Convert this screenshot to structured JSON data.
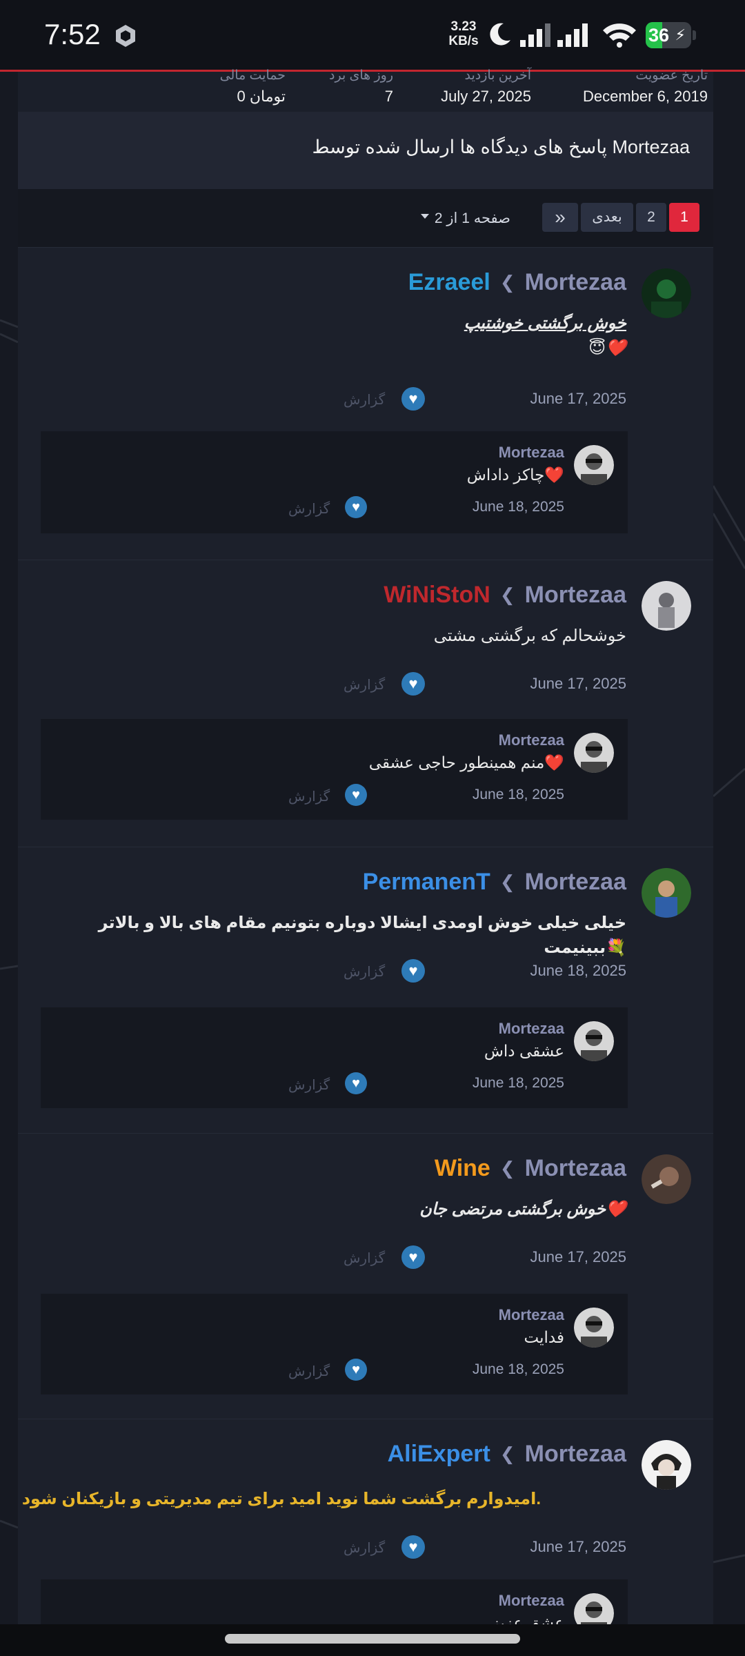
{
  "status_bar": {
    "time": "7:52",
    "net_speed_value": "3.23",
    "net_speed_unit": "KB/s",
    "battery_level": "36",
    "battery_fraction": 0.36,
    "icons": [
      "app-icon",
      "moon-icon",
      "signal-icon",
      "signal-icon",
      "wifi-icon",
      "battery-icon"
    ]
  },
  "stats": {
    "join_date_label": "تاریخ عضویت",
    "join_date": "December 6, 2019",
    "last_visit_label": "آخرین بازدید",
    "last_visit": "July 27, 2025",
    "wins_label": "روز های برد",
    "wins": "7",
    "support_label": "حمایت مالی",
    "support": "0 تومان"
  },
  "page_title": "پاسخ های دیدگاه ها ارسال شده توسط Mortezaa",
  "pagination": {
    "page_1": "1",
    "page_2": "2",
    "next": "بعدی",
    "last_icon": "»",
    "label": "صفحه 1 از 2"
  },
  "colors": {
    "accent": "#e0273c",
    "like": "#2e7bb8",
    "author": "#8b90b3"
  },
  "posts": [
    {
      "author": "Mortezaa",
      "target": "Ezraeel",
      "target_color": "#2a9bd8",
      "text_line1": "خوش برگشتی خوشتیپ",
      "text_line2": "😇❤️",
      "date": "June 17, 2025",
      "report": "گزارش",
      "reply": {
        "author": "Mortezaa",
        "text": "چاکز داداش❤️",
        "date": "June 18, 2025",
        "report": "گزارش"
      }
    },
    {
      "author": "Mortezaa",
      "target": "WiNiStoN",
      "target_color": "#c0282d",
      "text_line1": "خوشحالم که برگشتی مشتی",
      "date": "June 17, 2025",
      "report": "گزارش",
      "reply": {
        "author": "Mortezaa",
        "text": "منم همینطور حاجی عشقی❤️",
        "date": "June 18, 2025",
        "report": "گزارش"
      }
    },
    {
      "author": "Mortezaa",
      "target": "PermanenT",
      "target_color": "#3b8fe6",
      "text_line1": "خیلی خیلی خوش اومدی ایشالا دوباره بتونیم مقام های بالا و بالاتر ببینیمت💐",
      "date": "June 18, 2025",
      "report": "گزارش",
      "reply": {
        "author": "Mortezaa",
        "text": "عشقی داش",
        "date": "June 18, 2025",
        "report": "گزارش"
      }
    },
    {
      "author": "Mortezaa",
      "target": "Wine",
      "target_color": "#f39a1d",
      "text_line1": "خوش برگشتی مرتضی جان❤️",
      "date": "June 17, 2025",
      "report": "گزارش",
      "reply": {
        "author": "Mortezaa",
        "text": "فدایت",
        "date": "June 18, 2025",
        "report": "گزارش"
      }
    },
    {
      "author": "Mortezaa",
      "target": "AliExpert",
      "target_color": "#3b8fe6",
      "text_line1": "امیدوارم برگشت شما نوید امید برای تیم مدیریتی و بازیکنان شود.",
      "text_color": "#e7b52a",
      "date": "June 17, 2025",
      "report": "گزارش",
      "reply": {
        "author": "Mortezaa",
        "text": "عشق عزیز"
      }
    }
  ]
}
